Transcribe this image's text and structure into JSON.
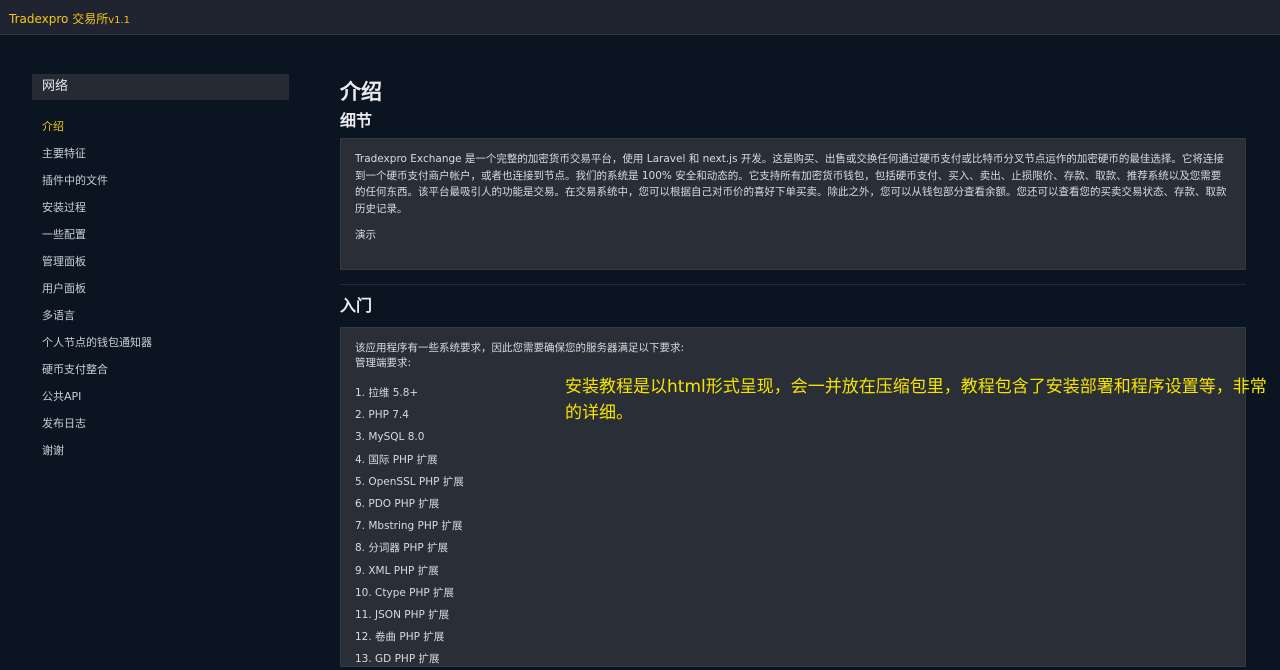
{
  "topbar": {
    "brand": "Tradexpro 交易所",
    "version": "v1.1"
  },
  "sidebar": {
    "header": "网络",
    "items": [
      {
        "label": "介绍",
        "active": true
      },
      {
        "label": "主要特征",
        "active": false
      },
      {
        "label": "插件中的文件",
        "active": false
      },
      {
        "label": "安装过程",
        "active": false
      },
      {
        "label": "一些配置",
        "active": false
      },
      {
        "label": "管理面板",
        "active": false
      },
      {
        "label": "用户面板",
        "active": false
      },
      {
        "label": "多语言",
        "active": false
      },
      {
        "label": "个人节点的钱包通知器",
        "active": false
      },
      {
        "label": "硬币支付整合",
        "active": false
      },
      {
        "label": "公共API",
        "active": false
      },
      {
        "label": "发布日志",
        "active": false
      },
      {
        "label": "谢谢",
        "active": false
      }
    ]
  },
  "main": {
    "title": "介绍",
    "details_heading": "细节",
    "details_text": "Tradexpro Exchange 是一个完整的加密货币交易平台，使用 Laravel 和 next.js 开发。这是购买、出售或交换任何通过硬币支付或比特币分叉节点运作的加密硬币的最佳选择。它将连接到一个硬币支付商户帐户，或者也连接到节点。我们的系统是 100% 安全和动态的。它支持所有加密货币钱包，包括硬币支付、买入、卖出、止损限价、存款、取款、推荐系统以及您需要的任何东西。该平台最吸引人的功能是交易。在交易系统中，您可以根据自己对币价的喜好下单买卖。除此之外，您可以从钱包部分查看余额。您还可以查看您的买卖交易状态、存款、取款历史记录。",
    "demo_label": "演示",
    "getting_started_heading": "入门",
    "requirements_intro": "该应用程序有一些系统要求，因此您需要确保您的服务器满足以下要求:",
    "server_requirements_label": "管理端要求:",
    "requirements": [
      "1. 拉维 5.8+",
      "2. PHP 7.4",
      "3. MySQL 8.0",
      "4. 国际 PHP 扩展",
      "5. OpenSSL PHP 扩展",
      "6. PDO PHP 扩展",
      "7. Mbstring PHP 扩展",
      "8. 分词器 PHP 扩展",
      "9. XML PHP 扩展",
      "10. Ctype PHP 扩展",
      "11. JSON PHP 扩展",
      "12. 卷曲 PHP 扩展",
      "13. GD PHP 扩展"
    ]
  },
  "overlay_note": "安装教程是以html形式呈现，会一并放在压缩包里，教程包含了安装部署和程序设置等，非常的详细。",
  "colors": {
    "background": "#0b1522",
    "topbar": "#1f2430",
    "card": "#2a2e36",
    "accent": "#f5c518",
    "note": "#f5e300"
  }
}
